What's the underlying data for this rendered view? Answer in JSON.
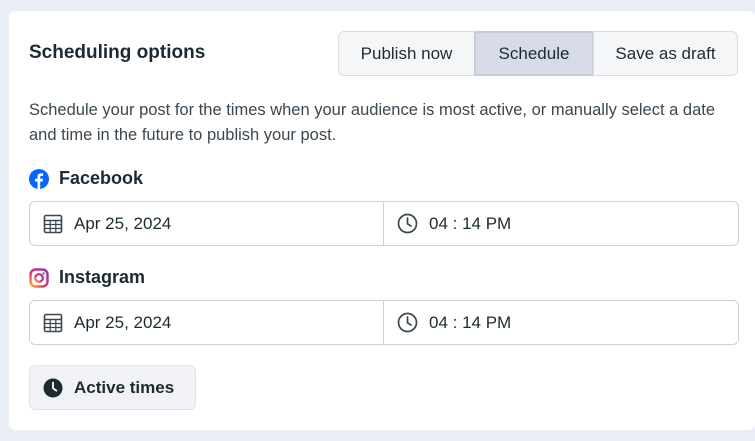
{
  "header": {
    "title": "Scheduling options"
  },
  "segmented": {
    "options": [
      "Publish now",
      "Schedule",
      "Save as draft"
    ],
    "selected": "Schedule"
  },
  "description": "Schedule your post for the times when your audience is most active, or manually select a date and time in the future to publish your post.",
  "platforms": [
    {
      "name": "Facebook",
      "icon": "facebook-icon",
      "date": "Apr 25, 2024",
      "time": "04 : 14 PM",
      "color": "#0866ff"
    },
    {
      "name": "Instagram",
      "icon": "instagram-icon",
      "date": "Apr 25, 2024",
      "time": "04 : 14 PM",
      "color": "#e1306c"
    }
  ],
  "active_times": {
    "label": "Active times",
    "icon": "clock-filled-icon"
  }
}
